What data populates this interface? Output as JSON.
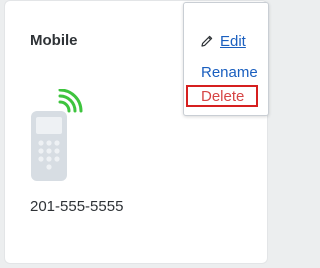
{
  "card": {
    "title": "Mobile",
    "phone_number": "201-555-5555",
    "device_icon": "mobile-phone-icon",
    "signal_icon": "wireless-signal-icon"
  },
  "menu": {
    "edit_label": "Edit",
    "edit_icon": "pencil-icon",
    "items": [
      {
        "label": "Rename"
      },
      {
        "label": "Delete"
      }
    ]
  },
  "colors": {
    "link": "#1a5fbf",
    "delete_text": "#d64545",
    "highlight_border": "#d61f1f",
    "signal": "#3ec43e",
    "phone_body": "#d7dde3"
  }
}
